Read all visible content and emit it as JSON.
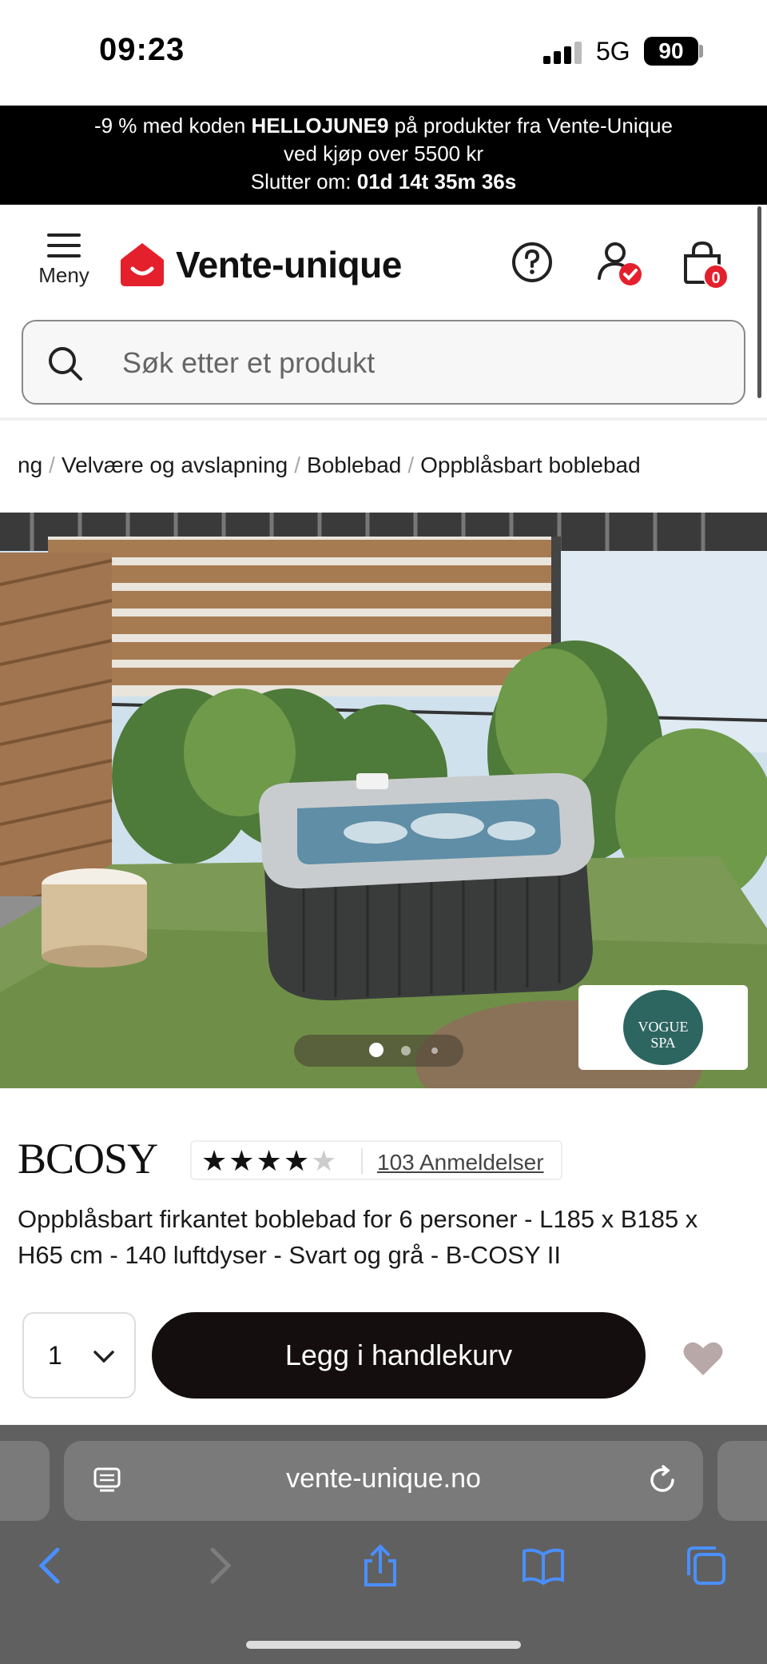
{
  "status_bar": {
    "time": "09:23",
    "network": "5G",
    "battery": "90"
  },
  "promo": {
    "line1_pre": "-9 % med koden ",
    "line1_code": "HELLOJUNE9",
    "line1_post": " på produkter fra Vente-Unique",
    "line2": "ved kjøp over 5500 kr",
    "line3_label": "Slutter om: ",
    "line3_countdown": "01d 14t 35m 36s"
  },
  "header": {
    "menu_label": "Meny",
    "logo_text": "Vente-unique",
    "cart_count": "0",
    "accent_color": "#e4202c"
  },
  "search": {
    "placeholder": "Søk etter et produkt"
  },
  "breadcrumb": [
    "ng",
    "Velvære og avslapning",
    "Boblebad",
    "Oppblåsbart boblebad"
  ],
  "product": {
    "brand": "BCOSY",
    "rating_stars": 4,
    "rating_max": 5,
    "reviews_label": "103 Anmeldelser",
    "description": "Oppblåsbart firkantet boblebad for 6 personer - L185 x B185 x H65 cm - 140 luftdyser - Svart og grå - B-COSY II",
    "image_badge_line1": "VOGUE",
    "image_badge_line2": "SPA",
    "carousel_active": 1,
    "carousel_total": 3
  },
  "purchase": {
    "quantity": "1",
    "add_to_cart_label": "Legg i handlekurv"
  },
  "browser": {
    "url": "vente-unique.no",
    "toolbar_icons": [
      "back-icon",
      "forward-icon",
      "share-icon",
      "bookmarks-icon",
      "tabs-icon"
    ]
  }
}
